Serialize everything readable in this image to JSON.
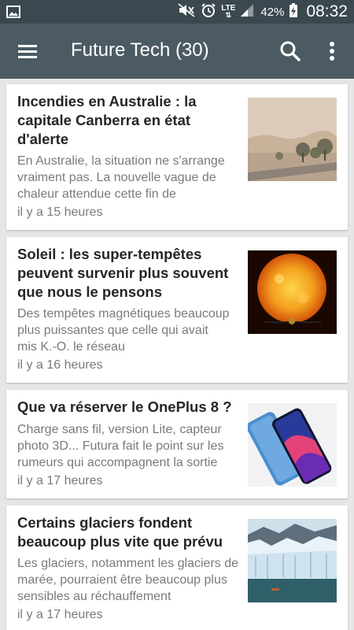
{
  "status": {
    "battery": "42%",
    "time": "08:32",
    "network": "LTE"
  },
  "appbar": {
    "title": "Future Tech (30)"
  },
  "articles": [
    {
      "title": "Incendies en Australie : la capitale Canberra en état d'alerte",
      "desc": "En Australie, la situation ne s'arrange vraiment pas. La nouvelle vague de chaleur attendue cette fin de",
      "when": "il y a 15 heures",
      "thumb": "bushfire-road-image"
    },
    {
      "title": "Soleil : les super-tempêtes peuvent survenir plus souvent que nous le pensons",
      "desc": "Des tempêtes magnétiques beaucoup plus puissantes que celle qui avait mis K.-O. le réseau",
      "when": "il y a 16 heures",
      "thumb": "sun-image"
    },
    {
      "title": "Que va réserver le OnePlus 8 ?",
      "desc": "Charge sans fil, version Lite, capteur photo 3D... Futura fait le point sur les rumeurs qui accompagnent la sortie",
      "when": "il y a 17 heures",
      "thumb": "smartphone-image"
    },
    {
      "title": "Certains glaciers fondent beaucoup plus vite que prévu",
      "desc": "Les glaciers, notamment les glaciers de marée, pourraient être beaucoup plus sensibles au réchauffement",
      "when": "il y a 17 heures",
      "thumb": "glacier-image"
    }
  ],
  "colors": {
    "statusbar": "#3b484f",
    "appbar": "#4c5b63",
    "background": "#e6e6e6"
  }
}
